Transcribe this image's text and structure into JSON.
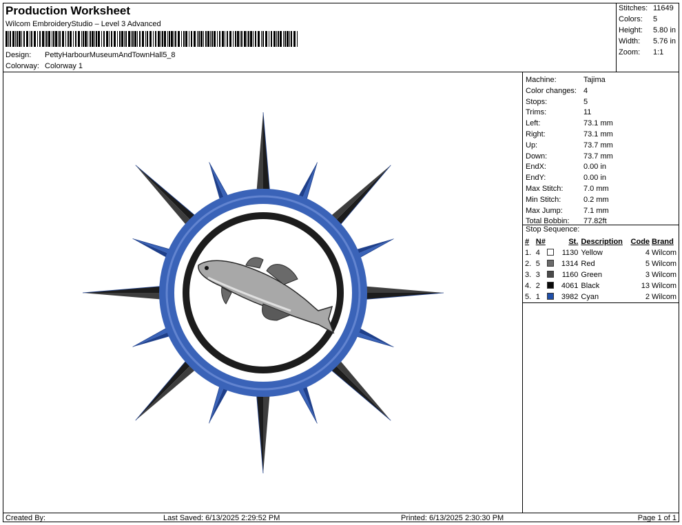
{
  "header": {
    "title": "Production Worksheet",
    "subtitle": "Wilcom EmbroideryStudio – Level 3 Advanced",
    "design_label": "Design:",
    "design_value": "PettyHarbourMuseumAndTownHall5_8",
    "colorway_label": "Colorway:",
    "colorway_value": "Colorway 1"
  },
  "summary": {
    "stitches_label": "Stitches:",
    "stitches_value": "11649",
    "colors_label": "Colors:",
    "colors_value": "5",
    "height_label": "Height:",
    "height_value": "5.80 in",
    "width_label": "Width:",
    "width_value": "5.76 in",
    "zoom_label": "Zoom:",
    "zoom_value": "1:1"
  },
  "info": {
    "rows": [
      {
        "label": "Machine:",
        "value": "Tajima"
      },
      {
        "label": "Color changes:",
        "value": "4"
      },
      {
        "label": "Stops:",
        "value": "5"
      },
      {
        "label": "Trims:",
        "value": "11"
      },
      {
        "label": "Left:",
        "value": "73.1 mm"
      },
      {
        "label": "Right:",
        "value": "73.1 mm"
      },
      {
        "label": "Up:",
        "value": "73.7 mm"
      },
      {
        "label": "Down:",
        "value": "73.7 mm"
      },
      {
        "label": "EndX:",
        "value": "0.00 in"
      },
      {
        "label": "EndY:",
        "value": "0.00 in"
      },
      {
        "label": "Max Stitch:",
        "value": "7.0 mm"
      },
      {
        "label": "Min Stitch:",
        "value": "0.2 mm"
      },
      {
        "label": "Max Jump:",
        "value": "7.1 mm"
      },
      {
        "label": "Total Bobbin:",
        "value": "77.82ft"
      }
    ],
    "stop_sequence_label": "Stop Sequence:"
  },
  "stops": {
    "headers": {
      "num": "#",
      "n": "N#",
      "st": "St.",
      "desc": "Description",
      "code": "Code",
      "brand": "Brand"
    },
    "rows": [
      {
        "num": "1.",
        "n": "4",
        "color": "#ffffff",
        "st": "1130",
        "desc": "Yellow",
        "code": "4",
        "brand": "Wilcom"
      },
      {
        "num": "2.",
        "n": "5",
        "color": "#6b6b6b",
        "st": "1314",
        "desc": "Red",
        "code": "5",
        "brand": "Wilcom"
      },
      {
        "num": "3.",
        "n": "3",
        "color": "#4a4a4a",
        "st": "1160",
        "desc": "Green",
        "code": "3",
        "brand": "Wilcom"
      },
      {
        "num": "4.",
        "n": "2",
        "color": "#0a0a0a",
        "st": "4061",
        "desc": "Black",
        "code": "13",
        "brand": "Wilcom"
      },
      {
        "num": "5.",
        "n": "1",
        "color": "#1f4fa8",
        "st": "3982",
        "desc": "Cyan",
        "code": "2",
        "brand": "Wilcom"
      }
    ]
  },
  "footer": {
    "created_by": "Created By:",
    "last_saved": "Last Saved: 6/13/2025 2:29:52 PM",
    "printed": "Printed: 6/13/2025 2:30:30 PM",
    "page": "Page 1 of 1"
  },
  "design": {
    "colors": {
      "blue": "#3a63b8",
      "blue_dark": "#1e3f8a",
      "black": "#1c1c1c",
      "gray": "#3d3d3d",
      "fish": "#9a9a9a"
    }
  }
}
